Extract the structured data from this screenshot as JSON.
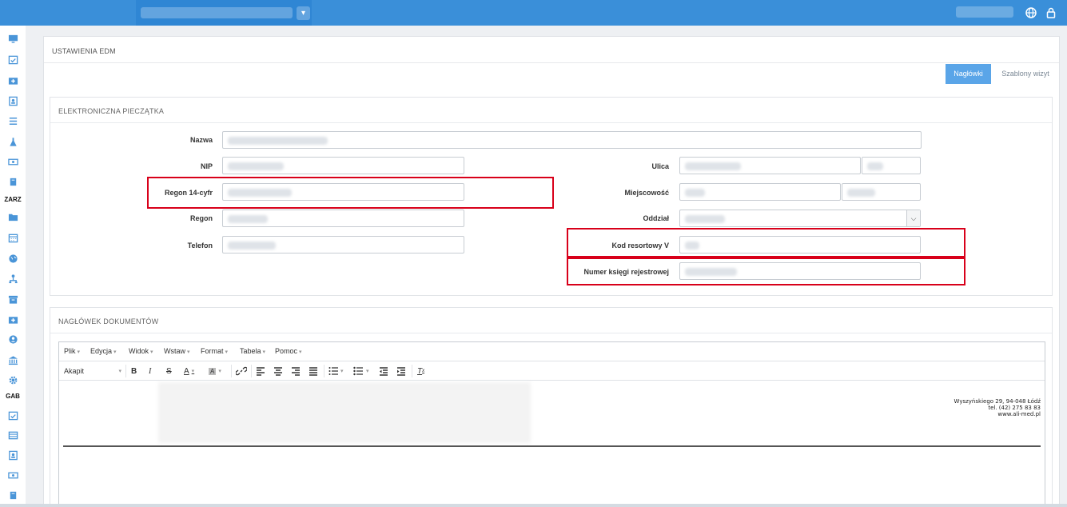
{
  "panel": {
    "title": "USTAWIENIA EDM"
  },
  "tabs": [
    {
      "label": "Nagłówki",
      "active": true
    },
    {
      "label": "Szablony wizyt",
      "active": false
    }
  ],
  "stamp": {
    "title": "ELEKTRONICZNA PIECZĄTKA",
    "fields": {
      "nazwa": "Nazwa",
      "nip": "NIP",
      "regon14": "Regon 14-cyfr",
      "regon": "Regon",
      "telefon": "Telefon",
      "ulica": "Ulica",
      "miejscowosc": "Miejscowość",
      "oddzial": "Oddział",
      "kod_resortowy": "Kod resortowy V",
      "numer_ksiegi": "Numer księgi rejestrowej"
    }
  },
  "header_docs": {
    "title": "NAGŁÓWEK DOKUMENTÓW"
  },
  "editor": {
    "menu": [
      "Plik",
      "Edycja",
      "Widok",
      "Wstaw",
      "Format",
      "Tabela",
      "Pomoc"
    ],
    "block_format": "Akapit",
    "address_lines": [
      "Wyszyńskiego 29, 94-048 Łódź",
      "tel. (42) 275 83 83",
      "www.ali-med.pl"
    ]
  },
  "sidebar": {
    "labels": {
      "zarz": "ZARZ",
      "gab": "GAB"
    }
  },
  "colors": {
    "topbar": "#3a8fd9",
    "accent": "#5aa5e8",
    "highlight": "#d8001a"
  }
}
